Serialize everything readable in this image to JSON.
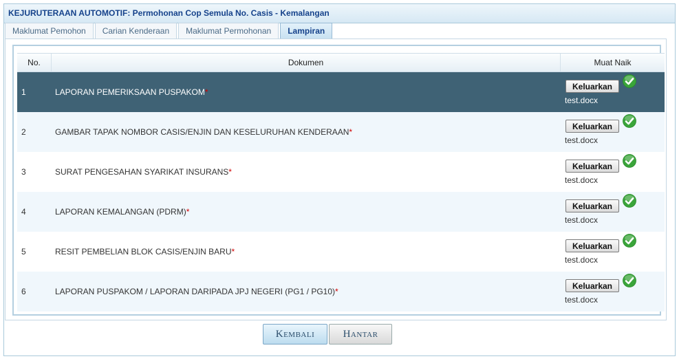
{
  "header": {
    "title": "KEJURUTERAAN AUTOMOTIF: Permohonan Cop Semula No. Casis - Kemalangan"
  },
  "tabs": [
    {
      "label": "Maklumat Pemohon",
      "active": false
    },
    {
      "label": "Carian Kenderaan",
      "active": false
    },
    {
      "label": "Maklumat Permohonan",
      "active": false
    },
    {
      "label": "Lampiran",
      "active": true
    }
  ],
  "table": {
    "columns": {
      "no": "No.",
      "document": "Dokumen",
      "upload": "Muat Naik"
    },
    "rows": [
      {
        "no": "1",
        "document": "LAPORAN PEMERIKSAAN PUSPAKOM",
        "required_mark": "*",
        "button": "Keluarkan",
        "file": "test.docx",
        "uploaded_icon": "check-circle-icon"
      },
      {
        "no": "2",
        "document": "GAMBAR TAPAK NOMBOR CASIS/ENJIN DAN KESELURUHAN KENDERAAN",
        "required_mark": "*",
        "button": "Keluarkan",
        "file": "test.docx",
        "uploaded_icon": "check-circle-icon"
      },
      {
        "no": "3",
        "document": "SURAT PENGESAHAN SYARIKAT INSURANS",
        "required_mark": "*",
        "button": "Keluarkan",
        "file": "test.docx",
        "uploaded_icon": "check-circle-icon"
      },
      {
        "no": "4",
        "document": "LAPORAN KEMALANGAN (PDRM)",
        "required_mark": "*",
        "button": "Keluarkan",
        "file": "test.docx",
        "uploaded_icon": "check-circle-icon"
      },
      {
        "no": "5",
        "document": "RESIT PEMBELIAN BLOK CASIS/ENJIN BARU",
        "required_mark": "*",
        "button": "Keluarkan",
        "file": "test.docx",
        "uploaded_icon": "check-circle-icon"
      },
      {
        "no": "6",
        "document": "LAPORAN PUSPAKOM / LAPORAN DARIPADA JPJ NEGERI (PG1 / PG10)",
        "required_mark": "*",
        "button": "Keluarkan",
        "file": "test.docx",
        "uploaded_icon": "check-circle-icon"
      }
    ]
  },
  "footer": {
    "back_label": "Kembali",
    "submit_label": "Hantar"
  },
  "colors": {
    "header_text": "#15428b",
    "selected_row": "#3f6275",
    "alt_row": "#f0f7fc",
    "required_mark": "#d00000",
    "success_icon": "#3aa53a"
  }
}
